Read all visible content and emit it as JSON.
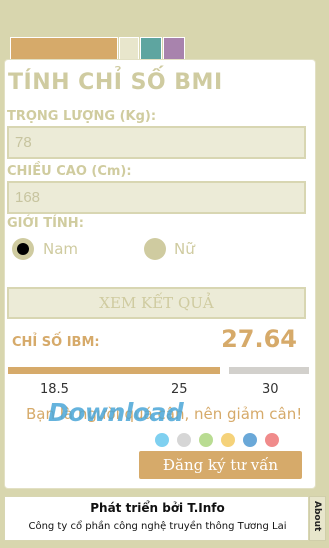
{
  "header": {
    "title": "TÍNH CHỈ SỐ BMI"
  },
  "form": {
    "weight_label": "TRỌNG LƯỢNG (Kg):",
    "weight_value": "78",
    "height_label": "CHIỀU CAO (Cm):",
    "height_value": "168",
    "gender_label": "GIỚI TÍNH:",
    "gender_options": [
      "Nam",
      "Nữ"
    ],
    "gender_selected": "Nam"
  },
  "actions": {
    "result_label": "XEM KẾT QUẢ",
    "register_label": "Đăng ký tư vấn"
  },
  "result": {
    "ibm_label": "CHỈ SỐ IBM:",
    "ibm_value": "27.64",
    "scale_ticks": [
      "18.5",
      "25",
      "30"
    ],
    "advice": "Bạn là người quá cân, nên giảm cân!"
  },
  "watermark": "Download",
  "theme_colors": [
    "#7fd0f0",
    "#d6d6d6",
    "#b9dc92",
    "#f5d27a",
    "#6aa8d8",
    "#f08b8b"
  ],
  "tab_colors": [
    "#d6aa6a",
    "#e8e6cc",
    "#5ea5a0",
    "#a883ad"
  ],
  "footer": {
    "title": "Phát triển bởi T.Info",
    "subtitle": "Công ty cổ phần công nghệ truyền thông Tương Lai",
    "about_label": "About"
  }
}
